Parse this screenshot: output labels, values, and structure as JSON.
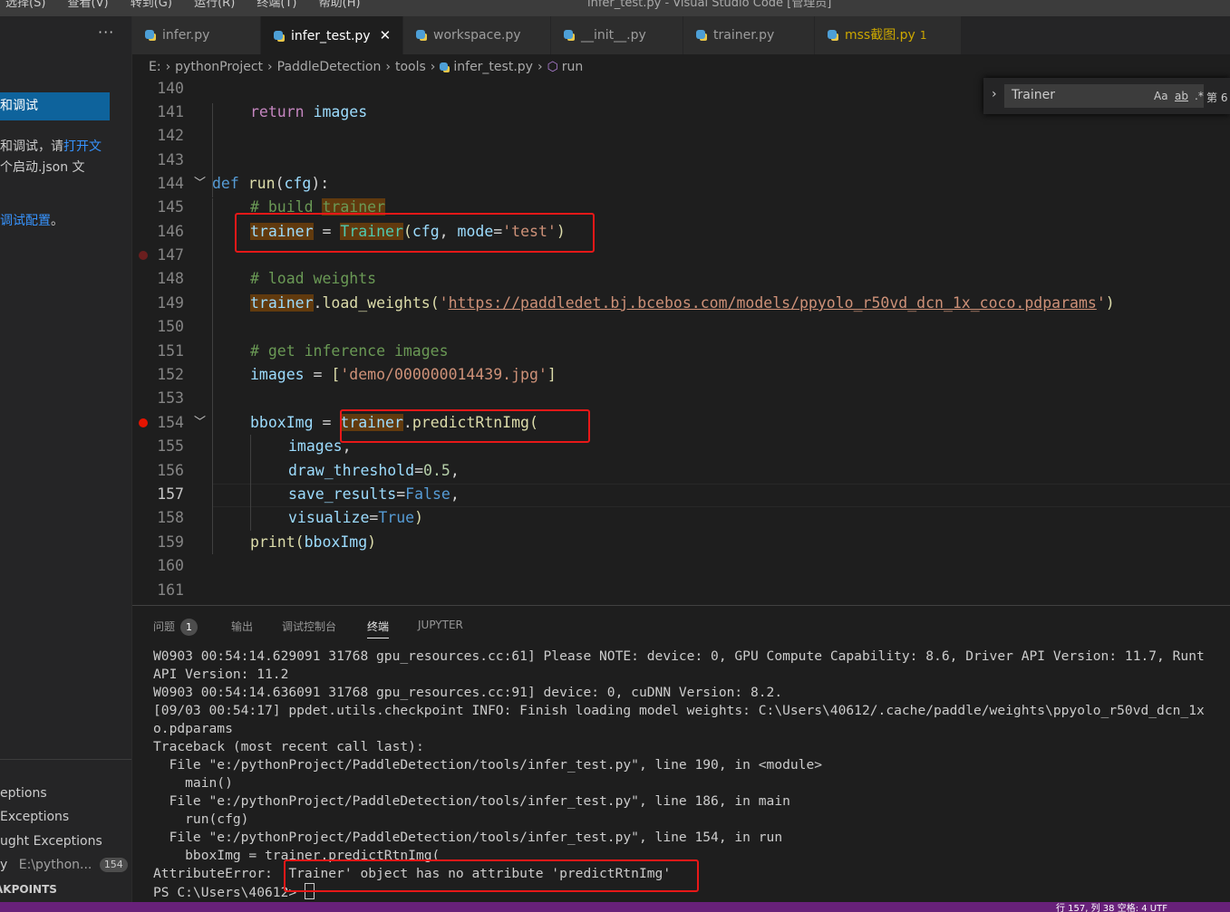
{
  "titlebar": {
    "menus": [
      "选择(S)",
      "查看(V)",
      "转到(G)",
      "运行(R)",
      "终端(T)",
      "帮助(H)"
    ],
    "window_title": "infer_test.py - Visual Studio Code [管理员]"
  },
  "sidebar": {
    "more": "···",
    "run_button": "行和调试",
    "text1_a": "和调试，请",
    "text1_link": "打开文",
    "text2": "个启动.json 文",
    "text3_link": "调试配置",
    "text3_end": "。",
    "breakpoints": [
      {
        "label": "eptions"
      },
      {
        "label": "Exceptions"
      },
      {
        "label": "ught Exceptions"
      }
    ],
    "bp_file": {
      "name": "y",
      "path": "E:\\python...",
      "line": "154"
    },
    "bp_title": "AKPOINTS"
  },
  "tabs": [
    {
      "label": "infer.py"
    },
    {
      "label": "infer_test.py",
      "close": "✕"
    },
    {
      "label": "workspace.py"
    },
    {
      "label": "__init__.py"
    },
    {
      "label": "trainer.py"
    },
    {
      "label": "mss截图.py",
      "badge": "1"
    }
  ],
  "breadcrumb": {
    "items": [
      "E:",
      "pythonProject",
      "PaddleDetection",
      "tools",
      "infer_test.py",
      "run"
    ],
    "sep": "›"
  },
  "find": {
    "chevron": "›",
    "value": "Trainer",
    "opt_case": "Aa",
    "opt_word": "ab",
    "opt_regex": ".*",
    "count": "第 6"
  },
  "editor": {
    "line_numbers": [
      "140",
      "141",
      "142",
      "143",
      "144",
      "145",
      "146",
      "147",
      "148",
      "149",
      "150",
      "151",
      "152",
      "153",
      "154",
      "155",
      "156",
      "157",
      "158",
      "159",
      "160",
      "161"
    ],
    "current_line": "157",
    "code": {
      "l141_kw": "return",
      "l141_var": "images",
      "l144_kw": "def",
      "l144_fn": "run",
      "l144_p1": "(",
      "l144_param": "cfg",
      "l144_p2": "):",
      "l145_cmt": "# build ",
      "l145_cmt_hl": "trainer",
      "l146_var": "trainer",
      "l146_eq": " = ",
      "l146_cls": "Trainer",
      "l146_p1": "(",
      "l146_arg": "cfg",
      "l146_comma": ", ",
      "l146_kwarg": "mode",
      "l146_eq2": "=",
      "l146_str": "'test'",
      "l146_p2": ")",
      "l148_cmt": "# load weights",
      "l149_var": "trainer",
      "l149_dot": ".",
      "l149_fn": "load_weights",
      "l149_p1": "(",
      "l149_q1": "'",
      "l149_url": "https://paddledet.bj.bcebos.com/models/ppyolo_r50vd_dcn_1x_coco.pdparams",
      "l149_q2": "'",
      "l149_p2": ")",
      "l151_cmt": "# get inference images",
      "l152_var": "images",
      "l152_eq": " = ",
      "l152_b1": "[",
      "l152_str": "'demo/000000014439.jpg'",
      "l152_b2": "]",
      "l154_var": "bboxImg",
      "l154_eq": " = ",
      "l154_var2": "trainer",
      "l154_dot": ".",
      "l154_fn": "predictRtnImg",
      "l154_p1": "(",
      "l155_var": "images",
      "l155_comma": ",",
      "l156_kwarg": "draw_threshold",
      "l156_eq": "=",
      "l156_num": "0.5",
      "l156_comma": ",",
      "l157_kwarg": "save_results",
      "l157_eq": "=",
      "l157_val": "False",
      "l157_comma": ",",
      "l158_kwarg": "visualize",
      "l158_eq": "=",
      "l158_val": "True",
      "l158_p": ")",
      "l159_fn": "print",
      "l159_p1": "(",
      "l159_var": "bboxImg",
      "l159_p2": ")"
    }
  },
  "panel": {
    "tabs": [
      {
        "label": "问题",
        "badge": "1"
      },
      {
        "label": "输出"
      },
      {
        "label": "调试控制台"
      },
      {
        "label": "终端"
      },
      {
        "label": "JUPYTER"
      }
    ],
    "terminal_lines": [
      "W0903 00:54:14.629091 31768 gpu_resources.cc:61] Please NOTE: device: 0, GPU Compute Capability: 8.6, Driver API Version: 11.7, Runt",
      "API Version: 11.2",
      "W0903 00:54:14.636091 31768 gpu_resources.cc:91] device: 0, cuDNN Version: 8.2.",
      "[09/03 00:54:17] ppdet.utils.checkpoint INFO: Finish loading model weights: C:\\Users\\40612/.cache/paddle/weights\\ppyolo_r50vd_dcn_1x",
      "o.pdparams",
      "Traceback (most recent call last):",
      "  File \"e:/pythonProject/PaddleDetection/tools/infer_test.py\", line 190, in <module>",
      "    main()",
      "  File \"e:/pythonProject/PaddleDetection/tools/infer_test.py\", line 186, in main",
      "    run(cfg)",
      "  File \"e:/pythonProject/PaddleDetection/tools/infer_test.py\", line 154, in run",
      "    bboxImg = trainer.predictRtnImg(",
      "AttributeError: 'Trainer' object has no attribute 'predictRtnImg'",
      "PS C:\\Users\\40612> "
    ]
  },
  "statusbar": {
    "text": "行 157, 列 38   空格: 4   UTF"
  },
  "colors": {
    "accent": "#0e639c",
    "statusbar": "#68217a",
    "annotation_red": "#e81818"
  }
}
